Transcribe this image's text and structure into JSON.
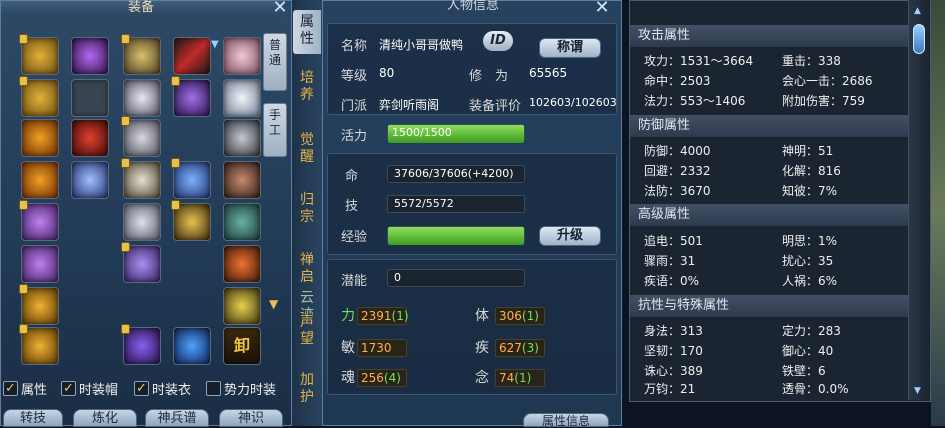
{
  "equipment_panel": {
    "title": "装备",
    "vertical_tabs": [
      {
        "label": "普\n通"
      },
      {
        "label": "手\n工"
      }
    ],
    "remove_label": "卸",
    "checkboxes": [
      {
        "label": "属性",
        "checked": true
      },
      {
        "label": "时装帽",
        "checked": true
      },
      {
        "label": "时装衣",
        "checked": true
      },
      {
        "label": "势力时装",
        "checked": false
      }
    ],
    "bottom_buttons": [
      "转技",
      "炼化",
      "神兵谱",
      "神识"
    ]
  },
  "side_tabs": [
    "属\n性",
    "培\n养",
    "觉\n醒",
    "归\n宗",
    "禅\n启",
    "云\n迹",
    "声\n望",
    "加\n护"
  ],
  "info_panel": {
    "title": "人物信息",
    "name_label": "名称",
    "name_value": "清纯小哥哥做鸭",
    "id_badge": "ID",
    "title_button": "称谓",
    "level_label": "等级",
    "level_value": "80",
    "cultivation_label": "修　为",
    "cultivation_value": "65565",
    "sect_label": "门派",
    "sect_value": "弈剑听雨阁",
    "gear_score_label": "装备评价",
    "gear_score_value": "102603/102603",
    "vitality_label": "活力",
    "vitality_value": "1500/1500",
    "vitality_fill": 1.0,
    "life_label": "命",
    "life_value": "37606/37606(+4200)",
    "skill_label": "技",
    "skill_value": "5572/5572",
    "exp_label": "经验",
    "exp_fill": 1.0,
    "upgrade_button": "升级",
    "potential_label": "潜能",
    "potential_value": "0",
    "stats": [
      {
        "label": "力",
        "value": "2391",
        "bonus": "(1)"
      },
      {
        "label": "体",
        "value": "306",
        "bonus": "(1)"
      },
      {
        "label": "敏",
        "value": "1730",
        "bonus": ""
      },
      {
        "label": "疾",
        "value": "627",
        "bonus": "(3)"
      },
      {
        "label": "魂",
        "value": "256",
        "bonus": "(4)"
      },
      {
        "label": "念",
        "value": "74",
        "bonus": "(1)"
      }
    ],
    "bottom_button": "属性信息"
  },
  "attr_panel": {
    "attack": {
      "title": "攻击属性",
      "rows": [
        [
          "攻力：1531～3664",
          "重击：338"
        ],
        [
          "命中：2503",
          "会心一击：2686"
        ],
        [
          "法力：553～1406",
          "附加伤害：759"
        ]
      ]
    },
    "defense": {
      "title": "防御属性",
      "rows": [
        [
          "防御：4000",
          "神明：51"
        ],
        [
          "回避：2332",
          "化解：816"
        ],
        [
          "法防：3670",
          "知彼：7%"
        ]
      ]
    },
    "advanced": {
      "title": "高级属性",
      "rows": [
        [
          "追电：501",
          "明思：1%"
        ],
        [
          "骤雨：31",
          "扰心：35"
        ],
        [
          "疾语：0%",
          "人祸：6%"
        ]
      ]
    },
    "resist": {
      "title": "抗性与特殊属性",
      "rows": [
        [
          "身法：313",
          "定力：283"
        ],
        [
          "坚韧：170",
          "御心：40"
        ],
        [
          "诛心：389",
          "铁壁：6"
        ],
        [
          "万钧：21",
          "透骨：0.0%"
        ]
      ]
    }
  },
  "colors": {
    "stat_value": "#ffb14a",
    "stat_bonus": "#6ee25a",
    "bar_green": "#5cc23a",
    "tab_gold": "#e3b24b"
  }
}
